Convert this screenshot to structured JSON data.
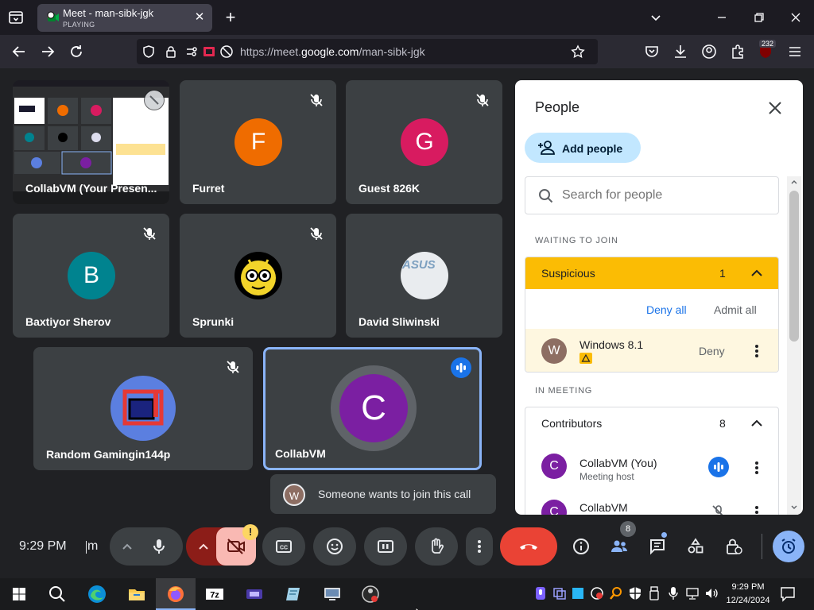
{
  "browser": {
    "tab": {
      "title": "Meet - man-sibk-jgk",
      "status": "PLAYING"
    },
    "url_prefix": "https://meet.",
    "url_domain": "google.com",
    "url_path": "/man-sibk-jgk",
    "extension_badge": "232"
  },
  "tiles": [
    {
      "name": "CollabVM (Your Presen...",
      "type": "screen-share"
    },
    {
      "name": "Furret",
      "initial": "F",
      "color": "#ef6c00",
      "muted": true
    },
    {
      "name": "Guest 826K",
      "initial": "G",
      "color": "#d81b60",
      "muted": true
    },
    {
      "name": "Baxtiyor Sherov",
      "initial": "B",
      "color": "#00838f",
      "muted": true
    },
    {
      "name": "Sprunki",
      "muted": true
    },
    {
      "name": "David Sliwinski",
      "avatar_text": "ASUS"
    },
    {
      "name": "Random Gamingin144p",
      "muted": true
    },
    {
      "name": "CollabVM",
      "initial": "C",
      "color": "#7b1fa2",
      "speaking": true
    }
  ],
  "people_panel": {
    "title": "People",
    "add_people": "Add people",
    "search_placeholder": "Search for people",
    "waiting_label": "WAITING TO JOIN",
    "waiting_group": {
      "title": "Suspicious",
      "count": "1",
      "deny_all": "Deny all",
      "admit_all": "Admit all"
    },
    "waiting_person": {
      "initial": "W",
      "name": "Windows 8.1",
      "deny": "Deny"
    },
    "in_meeting_label": "IN MEETING",
    "contributors": {
      "title": "Contributors",
      "count": "8"
    },
    "members": [
      {
        "initial": "C",
        "name": "CollabVM (You)",
        "role": "Meeting host"
      },
      {
        "initial": "C",
        "name": "CollabVM"
      }
    ]
  },
  "toast": {
    "initial": "W",
    "text": "Someone wants to join this call"
  },
  "controls": {
    "time": "9:29 PM",
    "meeting_code_fragment": "m",
    "people_count": "8",
    "camera_alert": "!"
  },
  "taskbar": {
    "time": "9:29 PM",
    "date": "12/24/2024"
  },
  "colors": {
    "accent_blue": "#1a73e8",
    "warning_yellow": "#fbbc04",
    "end_call_red": "#ea4335"
  }
}
